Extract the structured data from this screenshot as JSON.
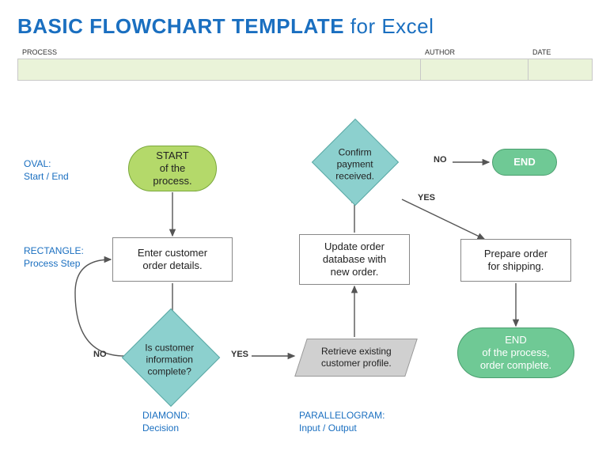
{
  "title_bold": "BASIC FLOWCHART TEMPLATE",
  "title_light": " for Excel",
  "headers": {
    "process": "PROCESS",
    "author": "AUTHOR",
    "date": "DATE"
  },
  "inputs": {
    "process": "",
    "author": "",
    "date": ""
  },
  "legend": {
    "oval_title": "OVAL:",
    "oval_sub": "Start / End",
    "rect_title": "RECTANGLE:",
    "rect_sub": "Process Step",
    "diamond_title": "DIAMOND:",
    "diamond_sub": "Decision",
    "para_title": "PARALLELOGRAM:",
    "para_sub": "Input / Output"
  },
  "nodes": {
    "start": "START\nof the process.",
    "enter": "Enter customer\norder details.",
    "complete": "Is customer\ninformation\ncomplete?",
    "retrieve": "Retrieve existing\ncustomer profile.",
    "update": "Update order\ndatabase with\nnew order.",
    "confirm": "Confirm\npayment\nreceived.",
    "prepare": "Prepare order\nfor shipping.",
    "end1": "END",
    "end2": "END\nof the process,\norder complete."
  },
  "edges": {
    "no": "NO",
    "yes": "YES"
  }
}
